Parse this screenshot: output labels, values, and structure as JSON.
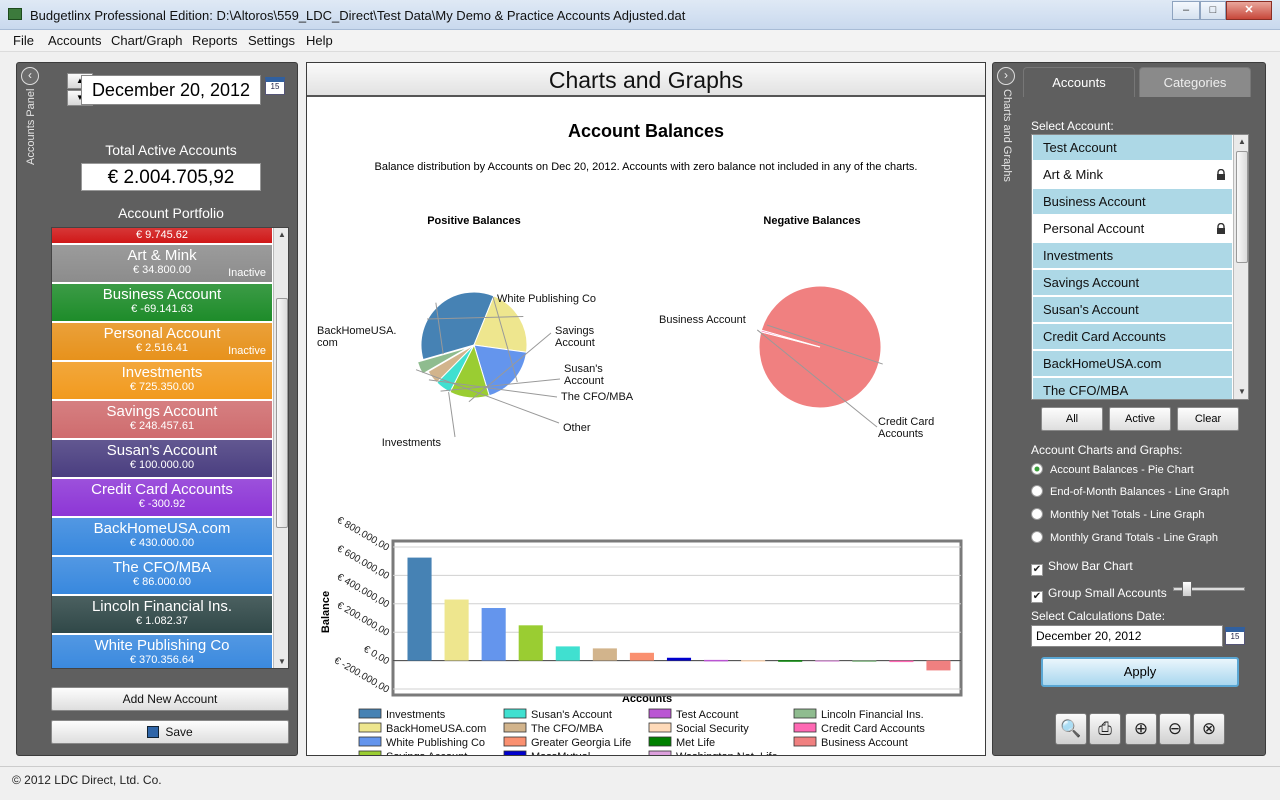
{
  "window": {
    "title": "Budgetlinx Professional Edition: D:\\Altoros\\559_LDC_Direct\\Test Data\\My Demo & Practice Accounts Adjusted.dat"
  },
  "menu": [
    "File",
    "Accounts",
    "Chart/Graph",
    "Reports",
    "Settings",
    "Help"
  ],
  "left_panel": {
    "side_label": "Accounts Panel",
    "date": "December 20, 2012",
    "total_label": "Total Active Accounts",
    "total_value": "€ 2.004.705,92",
    "portfolio_label": "Account Portfolio",
    "accounts": [
      {
        "name": "",
        "balance": "€ 9.745.62",
        "status": "",
        "color": "#d01818"
      },
      {
        "name": "Art & Mink",
        "balance": "€ 34.800.00",
        "status": "Inactive",
        "color": "#8c8c8c"
      },
      {
        "name": "Business Account",
        "balance": "€ -69.141.63",
        "status": "",
        "color": "#1e8c2a"
      },
      {
        "name": "Personal Account",
        "balance": "€ 2.516.41",
        "status": "Inactive",
        "color": "#e7921c"
      },
      {
        "name": "Investments",
        "balance": "€ 725.350.00",
        "status": "",
        "color": "#f19a1e"
      },
      {
        "name": "Savings Account",
        "balance": "€ 248.457.61",
        "status": "",
        "color": "#cf6c6e"
      },
      {
        "name": "Susan's Account",
        "balance": "€ 100.000.00",
        "status": "",
        "color": "#4a3e80"
      },
      {
        "name": "Credit Card Accounts",
        "balance": "€ -300.92",
        "status": "",
        "color": "#8d36d6"
      },
      {
        "name": "BackHomeUSA.com",
        "balance": "€ 430.000.00",
        "status": "",
        "color": "#3888de"
      },
      {
        "name": "The CFO/MBA",
        "balance": "€ 86.000.00",
        "status": "",
        "color": "#3888de"
      },
      {
        "name": "Lincoln Financial Ins.",
        "balance": "€ 1.082.37",
        "status": "",
        "color": "#304848"
      },
      {
        "name": "White Publishing Co",
        "balance": "€ 370.356.64",
        "status": "",
        "color": "#3888de"
      }
    ],
    "add_button": "Add New Account",
    "save_button": "Save"
  },
  "center_panel": {
    "header": "Charts and Graphs",
    "title": "Account Balances",
    "subtitle": "Balance distribution by Accounts on Dec 20, 2012. Accounts with zero balance not included in any of the charts.",
    "pie_positive_title": "Positive Balances",
    "pie_negative_title": "Negative Balances",
    "legend_title": "Accounts",
    "y_axis_label": "Balance",
    "y_ticks": [
      "€ 800.000,00",
      "€ 600.000,00",
      "€ 400.000,00",
      "€ 200.000,00",
      "€ 0,00",
      "€ -200.000,00"
    ]
  },
  "chart_data": [
    {
      "type": "pie",
      "title": "Positive Balances",
      "slices": [
        {
          "label": "Investments",
          "value": 725350,
          "color": "#4682b4"
        },
        {
          "label": "BackHomeUSA.\ncom",
          "value": 430000,
          "color": "#eee68e"
        },
        {
          "label": "White Publishing Co",
          "value": 370357,
          "color": "#6495ed"
        },
        {
          "label": "Savings\nAccount",
          "value": 248458,
          "color": "#9acd32"
        },
        {
          "label": "Susan's\nAccount",
          "value": 100000,
          "color": "#40e0d0"
        },
        {
          "label": "The CFO/MBA",
          "value": 86000,
          "color": "#d2b48c"
        },
        {
          "label": "Other",
          "value": 80000,
          "color": "#8fbc8f"
        }
      ]
    },
    {
      "type": "pie",
      "title": "Negative Balances",
      "slices": [
        {
          "label": "Business Account",
          "value": 69142,
          "color": "#f08080"
        },
        {
          "label": "Credit Card\nAccounts",
          "value": 301,
          "color": "#ff69b4"
        }
      ]
    },
    {
      "type": "bar",
      "xlabel": "Accounts",
      "ylabel": "Balance",
      "ylim": [
        -200000,
        800000
      ],
      "series": [
        {
          "name": "Investments",
          "value": 725350,
          "color": "#4682b4"
        },
        {
          "name": "BackHomeUSA.com",
          "value": 430000,
          "color": "#eee68e"
        },
        {
          "name": "White Publishing Co",
          "value": 370357,
          "color": "#6495ed"
        },
        {
          "name": "Savings Account",
          "value": 248458,
          "color": "#9acd32"
        },
        {
          "name": "Susan's Account",
          "value": 100000,
          "color": "#40e0d0"
        },
        {
          "name": "The CFO/MBA",
          "value": 86000,
          "color": "#d2b48c"
        },
        {
          "name": "Greater Georgia Life",
          "value": 55000,
          "color": "#fa9070"
        },
        {
          "name": "MassMutual",
          "value": 20000,
          "color": "#0000cd"
        },
        {
          "name": "Test Account",
          "value": 5000,
          "color": "#ba55d3"
        },
        {
          "name": "Social Security",
          "value": 3000,
          "color": "#ffdab9"
        },
        {
          "name": "Met Life",
          "value": 2500,
          "color": "#008000"
        },
        {
          "name": "Washington Nat. Life",
          "value": 2000,
          "color": "#dda0dd"
        },
        {
          "name": "Lincoln Financial Ins.",
          "value": 1082,
          "color": "#8fbc8f"
        },
        {
          "name": "Credit Card Accounts",
          "value": -301,
          "color": "#ff69b4"
        },
        {
          "name": "Business Account",
          "value": -69142,
          "color": "#f08080"
        }
      ]
    }
  ],
  "right_panel": {
    "side_label": "Charts and Graphs",
    "tabs": [
      "Accounts",
      "Categories"
    ],
    "select_label": "Select Account:",
    "account_list": [
      {
        "name": "Test Account",
        "locked": false,
        "selected": true
      },
      {
        "name": "Art & Mink",
        "locked": true,
        "selected": false
      },
      {
        "name": "Business Account",
        "locked": false,
        "selected": true
      },
      {
        "name": "Personal Account",
        "locked": true,
        "selected": false
      },
      {
        "name": "Investments",
        "locked": false,
        "selected": true
      },
      {
        "name": "Savings Account",
        "locked": false,
        "selected": true
      },
      {
        "name": "Susan's Account",
        "locked": false,
        "selected": true
      },
      {
        "name": "Credit Card Accounts",
        "locked": false,
        "selected": true
      },
      {
        "name": "BackHomeUSA.com",
        "locked": false,
        "selected": true
      },
      {
        "name": "The CFO/MBA",
        "locked": false,
        "selected": true
      }
    ],
    "buttons": [
      "All",
      "Active",
      "Clear"
    ],
    "charts_label": "Account Charts and Graphs:",
    "chart_options": [
      "Account Balances - Pie Chart",
      "End-of-Month Balances - Line Graph",
      "Monthly Net Totals - Line Graph",
      "Monthly Grand Totals - Line Graph"
    ],
    "selected_option": 0,
    "show_bar_chart": "Show Bar Chart",
    "group_small": "Group Small Accounts",
    "calc_date_label": "Select Calculations Date:",
    "calc_date": "December 20, 2012",
    "apply": "Apply",
    "tools": [
      "preview-icon",
      "print-icon",
      "zoom-in-icon",
      "zoom-out-icon",
      "zoom-reset-icon"
    ]
  },
  "status": {
    "copyright": "© 2012 LDC Direct, Ltd. Co."
  }
}
